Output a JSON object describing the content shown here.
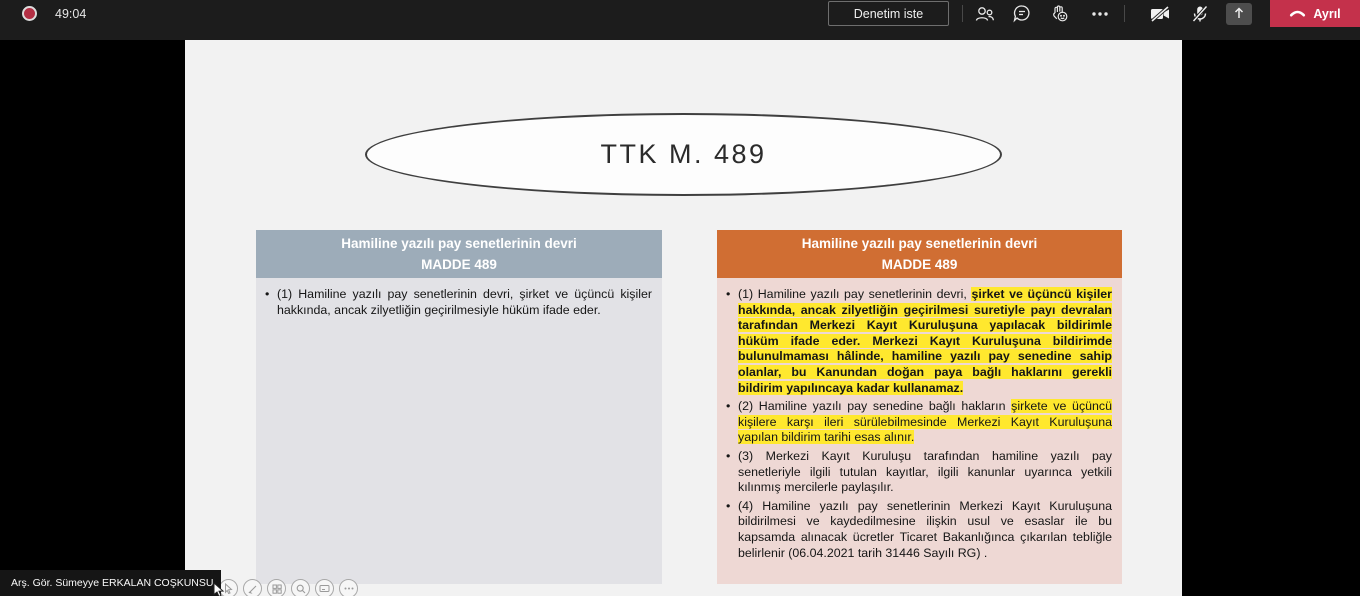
{
  "topbar": {
    "timer": "49:04",
    "request_control": "Denetim iste",
    "leave": "Ayrıl"
  },
  "presenter_tag": "Arş. Gör. Sümeyye ERKALAN COŞKUNSU",
  "bullet_char": "•",
  "slide": {
    "title": "TTK M. 489",
    "left_box": {
      "header_line1": "Hamiline yazılı pay senetlerinin devri",
      "header_line2": "MADDE 489",
      "bullet": "(1) Hamiline yazılı pay senetlerinin devri, şirket ve üçüncü kişiler hakkında, ancak zilyetliğin geçirilmesiyle hüküm ifade eder."
    },
    "right_box": {
      "header_line1": "Hamiline yazılı pay senetlerinin devri",
      "header_line2": "MADDE 489",
      "bullets": [
        {
          "pre": "(1) Hamiline yazılı pay senetlerinin devri, ",
          "highlight_bold": "şirket ve üçüncü kişiler hakkında, ancak zilyetliğin geçirilmesi suretiyle payı devralan tarafından Merkezi Kayıt Kuruluşuna yapılacak bildirimle hüküm ifade eder. Merkezi Kayıt Kuruluşuna bildirimde bulunulmaması hâlinde, hamiline yazılı pay senedine sahip olanlar, bu Kanundan doğan paya bağlı haklarını gerekli bildirim yapılıncaya kadar kullanamaz."
        },
        {
          "pre": "(2) Hamiline yazılı pay senedine bağlı hakların ",
          "highlight": "şirkete ve üçüncü kişilere karşı ileri sürülebilmesinde Merkezi Kayıt Kuruluşuna yapılan bildirim tarihi esas alınır."
        },
        {
          "text": "(3) Merkezi Kayıt Kuruluşu tarafından hamiline yazılı pay senetleriyle ilgili tutulan kayıtlar, ilgili kanunlar uyarınca yetkili kılınmış mercilerle paylaşılır."
        },
        {
          "text": "(4) Hamiline yazılı pay senetlerinin Merkezi Kayıt Kuruluşuna bildirilmesi ve kaydedilmesine ilişkin usul ve esaslar ile bu kapsamda alınacak ücretler Ticaret Bakanlığınca çıkarılan tebliğle belirlenir (06.04.2021 tarih 31446 Sayılı RG) ."
        }
      ]
    }
  },
  "icons": {
    "topbar": [
      "recording-indicator",
      "people-icon",
      "chat-icon",
      "reactions-icon",
      "more-icon",
      "camera-off-icon",
      "mic-off-icon",
      "share-tray-icon",
      "hangup-icon"
    ],
    "slideshow_toolbar": [
      "hidden-icon",
      "pointer-arrow-icon",
      "pen-icon",
      "thumbnails-icon",
      "magnifier-icon",
      "captions-icon",
      "more-dots-icon"
    ],
    "mouse_cursor": "mouse-cursor"
  },
  "colors": {
    "topbar_bg": "#1c1c1c",
    "stage_bg": "#000000",
    "slide_bg": "#f2f2f2",
    "accent_red": "#c4314b",
    "left_header": "#9dacb9",
    "left_body": "#e2e2e6",
    "right_header": "#d06e33",
    "right_body": "#eed8d4",
    "highlight_yellow": "#ffe82e"
  }
}
